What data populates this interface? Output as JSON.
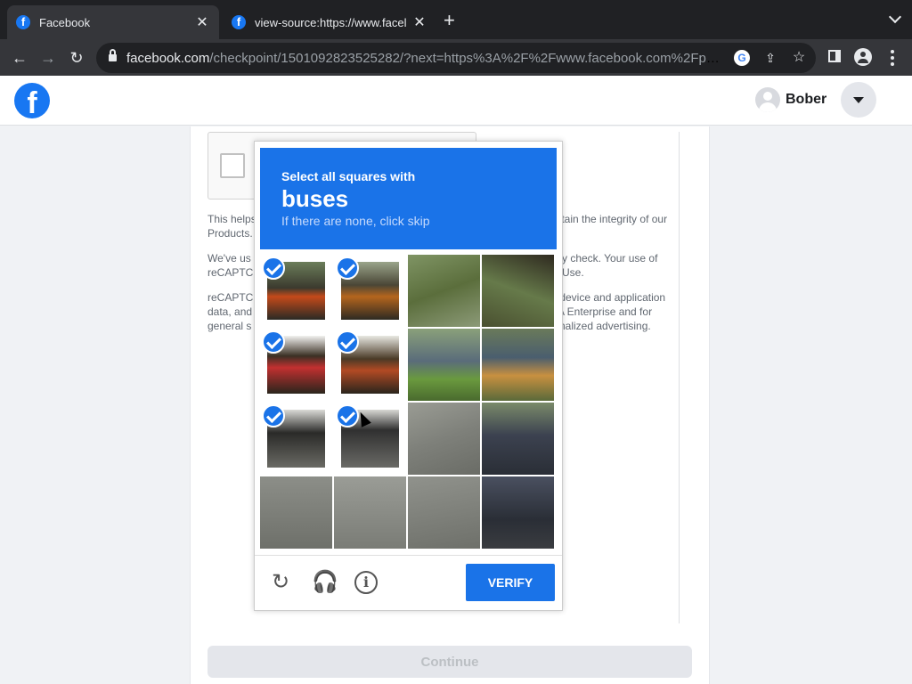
{
  "browser": {
    "tabs": [
      {
        "title": "Facebook",
        "favicon": "facebook-icon",
        "active": true
      },
      {
        "title": "view-source:https://www.facel",
        "favicon": "facebook-icon",
        "active": false
      }
    ],
    "new_tab_symbol": "+",
    "url_host": "facebook.com",
    "url_path": "/checkpoint/1501092823525282/?next=https%3A%2F%2Fwww.facebook.com%2Fpu...",
    "icons": [
      "back-icon",
      "forward-icon",
      "reload-icon",
      "lock-icon",
      "google-icon",
      "share-icon",
      "star-icon",
      "sidepanel-icon",
      "profile-icon",
      "menu-icon"
    ]
  },
  "header": {
    "logo_letter": "f",
    "user_name": "Bober"
  },
  "policy": {
    "p1_left": "This helps",
    "p1_right": "intain the integrity of our",
    "p1_line2": "Products.",
    "p2_left": "We've us",
    "p2_right": "y check. Your use of",
    "p2_line2_left": "reCAPTC",
    "p2_line2_right": "Use.",
    "p3_left": "reCAPTC",
    "p3_right": "s device and application",
    "p3_line2_left": "data, and",
    "p3_line2_right": "A Enterprise and for",
    "p3_line3_left": "general s",
    "p3_line3_right": "nalized advertising."
  },
  "captcha": {
    "instruction": "Select all squares with",
    "target": "buses",
    "hint": "If there are none, click skip",
    "verify_label": "VERIFY",
    "accent_color": "#1a73e8",
    "tiles": [
      {
        "row": 0,
        "col": 0,
        "selected": true
      },
      {
        "row": 0,
        "col": 1,
        "selected": true
      },
      {
        "row": 0,
        "col": 2,
        "selected": false
      },
      {
        "row": 0,
        "col": 3,
        "selected": false
      },
      {
        "row": 1,
        "col": 0,
        "selected": true
      },
      {
        "row": 1,
        "col": 1,
        "selected": true
      },
      {
        "row": 1,
        "col": 2,
        "selected": false
      },
      {
        "row": 1,
        "col": 3,
        "selected": false
      },
      {
        "row": 2,
        "col": 0,
        "selected": true
      },
      {
        "row": 2,
        "col": 1,
        "selected": true
      },
      {
        "row": 2,
        "col": 2,
        "selected": false
      },
      {
        "row": 2,
        "col": 3,
        "selected": false
      },
      {
        "row": 3,
        "col": 0,
        "selected": false
      },
      {
        "row": 3,
        "col": 1,
        "selected": false
      },
      {
        "row": 3,
        "col": 2,
        "selected": false
      },
      {
        "row": 3,
        "col": 3,
        "selected": false
      }
    ]
  },
  "continue_label": "Continue"
}
